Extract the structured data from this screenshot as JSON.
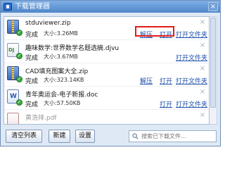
{
  "window": {
    "title": "下载管理器",
    "close_glyph": "×"
  },
  "items": [
    {
      "name": "stduviewer.zip",
      "status": "完成",
      "size": "大小:3.26MB",
      "icon": "zip-icon",
      "extract_label": "解压",
      "open_label": "打开",
      "folder_label": "打开文件夹",
      "remove_glyph": "×"
    },
    {
      "name": "趣味数学:世界数学名题选摘.djvu",
      "status": "完成",
      "size": "大小:3.67MB",
      "icon": "djvu-icon",
      "folder_label": "打开文件夹",
      "remove_glyph": "×"
    },
    {
      "name": "CAD填充图案大全.zip",
      "status": "完成",
      "size": "大小:323.14KB",
      "icon": "zip-icon",
      "extract_label": "解压",
      "open_label": "打开",
      "folder_label": "打开文件夹",
      "remove_glyph": "×"
    },
    {
      "name": "青年奥运会-电子新报.doc",
      "status": "完成",
      "size": "大小:57.50KB",
      "icon": "doc-icon",
      "open_label": "打开",
      "folder_label": "打开文件夹",
      "remove_glyph": "×"
    },
    {
      "name": "黄浩排.pdf",
      "icon": "pdf-icon",
      "remove_glyph": "×"
    }
  ],
  "footer": {
    "clear_label": "清空列表",
    "new_label": "新建",
    "settings_label": "设置",
    "search_placeholder": "搜索已下载文件..."
  },
  "colors": {
    "highlight": "#e21b1b",
    "link": "#1d4fa8",
    "titlebar": "#4f86c9"
  }
}
